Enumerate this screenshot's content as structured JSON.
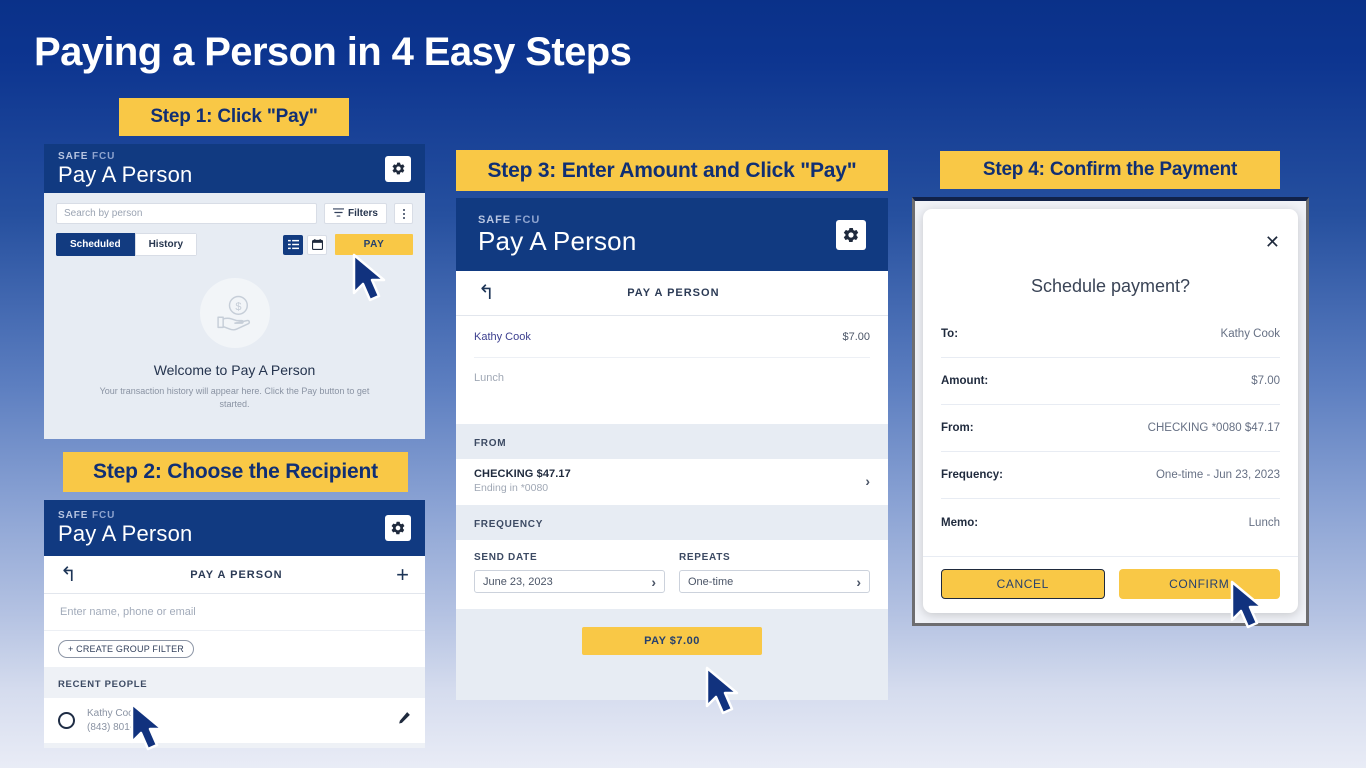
{
  "page": {
    "title": "Paying a Person in 4 Easy Steps",
    "bg_top_color": "#0a3189",
    "bg_bottom_color": "#e9ecf6",
    "accent_yellow": "#f9c846",
    "brand_navy": "#113a81"
  },
  "badges": {
    "step1": "Step 1: Click \"Pay\"",
    "step2": "Step 2: Choose the Recipient",
    "step3": "Step 3: Enter Amount and Click \"Pay\"",
    "step4": "Step 4: Confirm the Payment"
  },
  "app": {
    "brand_line1_bold": "SAFE",
    "brand_line1_light": "FCU",
    "brand_line2": "Pay A Person",
    "screen_title": "PAY A PERSON"
  },
  "step1": {
    "search_placeholder": "Search by person",
    "filters_label": "Filters",
    "tab_scheduled": "Scheduled",
    "tab_history": "History",
    "pay_label": "PAY",
    "empty_title": "Welcome to Pay A Person",
    "empty_sub": "Your transaction history will appear here. Click the Pay button to get started."
  },
  "step2": {
    "search_placeholder": "Enter name, phone or email",
    "create_group_filter": "+ CREATE GROUP FILTER",
    "recent_people_label": "RECENT PEOPLE",
    "person_name": "Kathy Cook",
    "person_phone": "(843) 801-3"
  },
  "step3": {
    "recipient": "Kathy Cook",
    "amount": "$7.00",
    "memo": "Lunch",
    "from_label": "FROM",
    "account_name": "CHECKING  $47.17",
    "account_sub": "Ending in *0080",
    "frequency_label": "FREQUENCY",
    "send_date_label": "SEND DATE",
    "send_date_value": "June 23, 2023",
    "repeats_label": "REPEATS",
    "repeats_value": "One-time",
    "pay_button": "PAY $7.00"
  },
  "step4": {
    "modal_title": "Schedule payment?",
    "rows": [
      {
        "key": "To:",
        "value": "Kathy Cook"
      },
      {
        "key": "Amount:",
        "value": "$7.00"
      },
      {
        "key": "From:",
        "value": "CHECKING *0080  $47.17"
      },
      {
        "key": "Frequency:",
        "value": "One-time - Jun 23, 2023"
      },
      {
        "key": "Memo:",
        "value": "Lunch"
      }
    ],
    "cancel_label": "CANCEL",
    "confirm_label": "CONFIRM"
  }
}
